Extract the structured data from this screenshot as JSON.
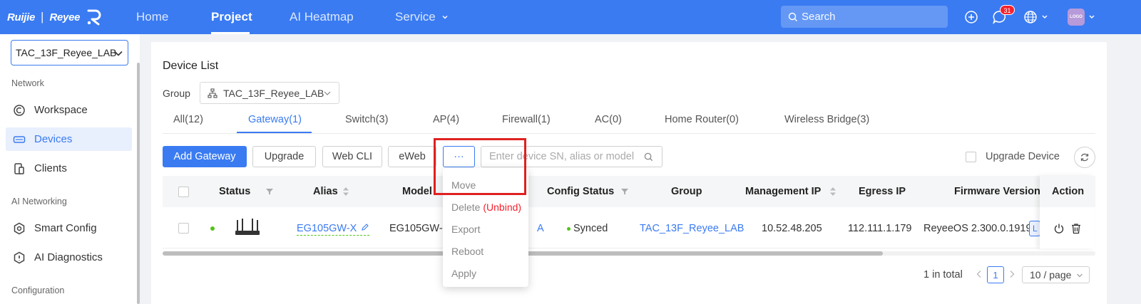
{
  "topnav": {
    "logo_text": "Ruijie",
    "logo_sub": "Reyee",
    "logo_separator": "|",
    "nav": [
      "Home",
      "Project",
      "AI Heatmap",
      "Service"
    ],
    "active_nav": "Project",
    "search_placeholder": "Search",
    "notification_count": "31",
    "avatar_text": "LOGO",
    "accent": "#3a7bf2"
  },
  "sidebar": {
    "project": "TAC_13F_Reyee_LAB",
    "sections": {
      "network": "Network",
      "ai_networking": "AI Networking",
      "configuration": "Configuration"
    },
    "items": {
      "workspace": "Workspace",
      "devices": "Devices",
      "clients": "Clients",
      "smart_config": "Smart Config",
      "ai_diagnostics": "AI Diagnostics"
    }
  },
  "main": {
    "title": "Device List",
    "group_label": "Group",
    "group_value": "TAC_13F_Reyee_LAB",
    "tabs": [
      "All(12)",
      "Gateway(1)",
      "Switch(3)",
      "AP(4)",
      "Firewall(1)",
      "AC(0)",
      "Home Router(0)",
      "Wireless Bridge(3)"
    ],
    "active_tab": "Gateway(1)",
    "toolbar": {
      "add": "Add Gateway",
      "upgrade": "Upgrade",
      "webcli": "Web CLI",
      "eweb": "eWeb",
      "more": "···",
      "filter_placeholder": "Enter device SN, alias or model",
      "upgrade_device": "Upgrade Device"
    },
    "columns": {
      "status": "Status",
      "alias": "Alias",
      "model": "Model",
      "config_status": "Config Status",
      "group": "Group",
      "management_ip": "Management IP",
      "egress_ip": "Egress IP",
      "firmware": "Firmware Version",
      "action": "Action"
    },
    "row": {
      "alias": "EG105GW-X",
      "model": "EG105GW-X",
      "model_tail": "A",
      "config_status": "Synced",
      "group": "TAC_13F_Reyee_LAB",
      "management_ip": "10.52.48.205",
      "egress_ip": "112.111.1.179",
      "firmware": "ReyeeOS 2.300.0.1919",
      "firmware_tag": "L"
    },
    "pager": {
      "total": "1 in total",
      "page": "1",
      "page_size": "10 / page"
    }
  },
  "dropdown": {
    "move": "Move",
    "delete": "Delete",
    "unbind": "(Unbind)",
    "export": "Export",
    "reboot": "Reboot",
    "apply": "Apply"
  }
}
